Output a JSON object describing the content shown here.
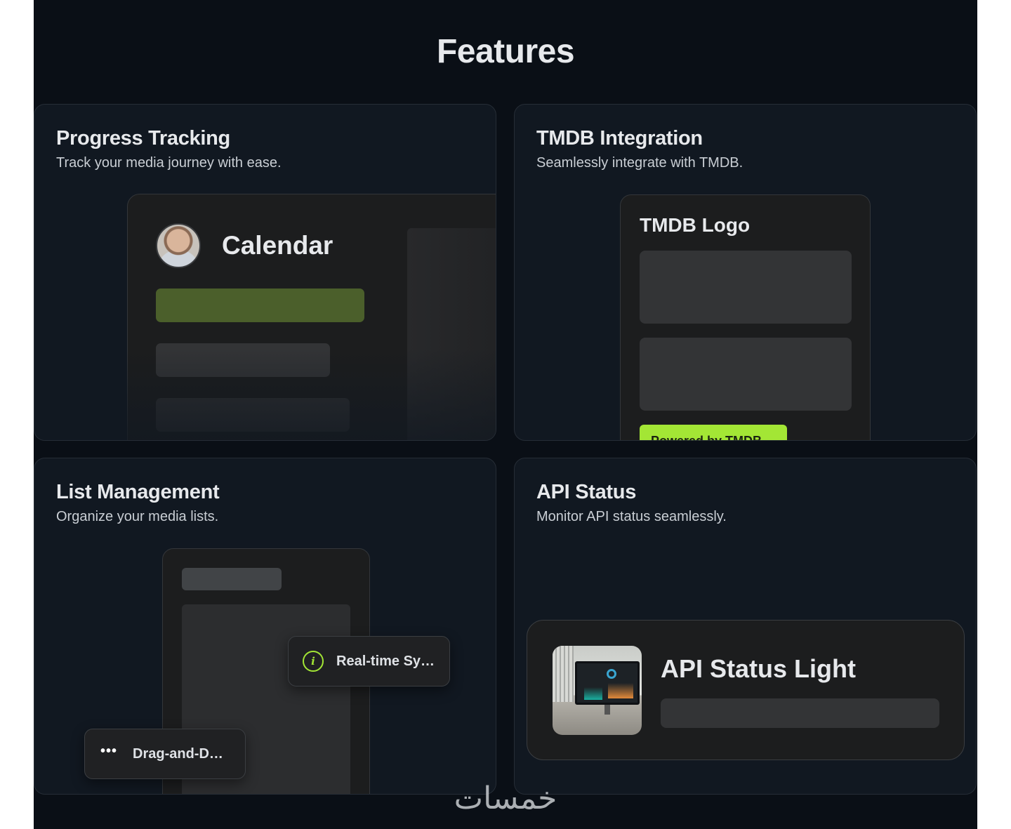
{
  "page": {
    "heading": "Features"
  },
  "cards": {
    "progress": {
      "title": "Progress Tracking",
      "description": "Track your media journey with ease.",
      "mock_title": "Calendar"
    },
    "tmdb": {
      "title": "TMDB Integration",
      "description": "Seamlessly integrate with TMDB.",
      "mock_title": "TMDB Logo",
      "badge": "Powered by TMDB"
    },
    "list": {
      "title": "List Management",
      "description": "Organize your media lists.",
      "toast_sync": "Real-time Sy…",
      "toast_drag": "Drag-and-D…"
    },
    "api": {
      "title": "API Status",
      "description": "Monitor API status seamlessly.",
      "mock_title": "API Status Light"
    }
  },
  "icons": {
    "info": "info-icon",
    "more": "more-dots-icon"
  },
  "colors": {
    "background": "#0a0f16",
    "card": "#111821",
    "accent": "#a3e635",
    "accent_muted": "#4b5f2b"
  },
  "watermark": "خمسات"
}
